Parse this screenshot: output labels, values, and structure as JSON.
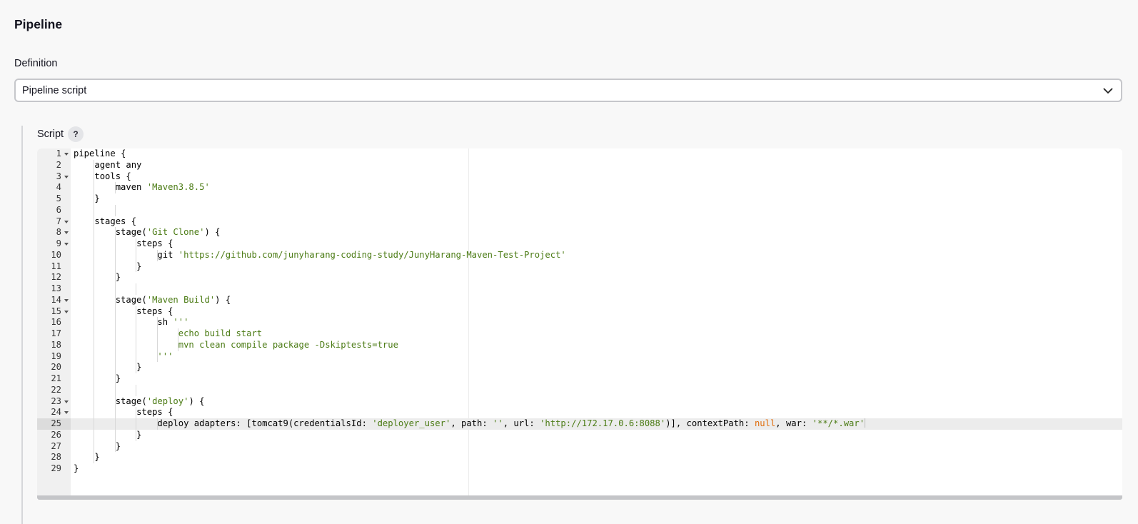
{
  "section": {
    "title": "Pipeline"
  },
  "definition": {
    "label": "Definition",
    "selected": "Pipeline script",
    "chevron_icon": "chevron-down-icon"
  },
  "script": {
    "label": "Script",
    "help": "?",
    "active_line": 25,
    "foldable_lines": [
      1,
      3,
      7,
      8,
      9,
      14,
      15,
      23,
      24
    ],
    "lines": [
      [
        {
          "t": "pipeline {"
        }
      ],
      [
        {
          "t": "agent any"
        }
      ],
      [
        {
          "t": "tools {"
        }
      ],
      [
        {
          "t": "maven "
        },
        {
          "t": "'Maven3.8.5'",
          "c": "str"
        }
      ],
      [
        {
          "t": "}"
        }
      ],
      [],
      [
        {
          "t": "stages {"
        }
      ],
      [
        {
          "t": "stage("
        },
        {
          "t": "'Git Clone'",
          "c": "str"
        },
        {
          "t": ") {"
        }
      ],
      [
        {
          "t": "steps {"
        }
      ],
      [
        {
          "t": "git "
        },
        {
          "t": "'https://github.com/junyharang-coding-study/JunyHarang-Maven-Test-Project'",
          "c": "str"
        }
      ],
      [
        {
          "t": "}"
        }
      ],
      [
        {
          "t": "}"
        }
      ],
      [],
      [
        {
          "t": "stage("
        },
        {
          "t": "'Maven Build'",
          "c": "str"
        },
        {
          "t": ") {"
        }
      ],
      [
        {
          "t": "steps {"
        }
      ],
      [
        {
          "t": "sh "
        },
        {
          "t": "'''",
          "c": "str"
        }
      ],
      [
        {
          "t": "echo build start",
          "c": "str"
        }
      ],
      [
        {
          "t": "mvn clean compile package -Dskiptests=true",
          "c": "str"
        }
      ],
      [
        {
          "t": "'''",
          "c": "str"
        }
      ],
      [
        {
          "t": "}"
        }
      ],
      [
        {
          "t": "}"
        }
      ],
      [],
      [
        {
          "t": "stage("
        },
        {
          "t": "'deploy'",
          "c": "str"
        },
        {
          "t": ") {"
        }
      ],
      [
        {
          "t": "steps {"
        }
      ],
      [
        {
          "t": "deploy adapters: [tomcat9(credentialsId: "
        },
        {
          "t": "'deployer_user'",
          "c": "str"
        },
        {
          "t": ", path: "
        },
        {
          "t": "''",
          "c": "str"
        },
        {
          "t": ", url: "
        },
        {
          "t": "'http://172.17.0.6:8088'",
          "c": "str"
        },
        {
          "t": ")], contextPath: "
        },
        {
          "t": "null",
          "c": "kw"
        },
        {
          "t": ", war: "
        },
        {
          "t": "'**/*.war'",
          "c": "str"
        }
      ],
      [
        {
          "t": "}"
        }
      ],
      [
        {
          "t": "}"
        }
      ],
      [
        {
          "t": "}"
        }
      ],
      [
        {
          "t": "}"
        }
      ]
    ]
  }
}
